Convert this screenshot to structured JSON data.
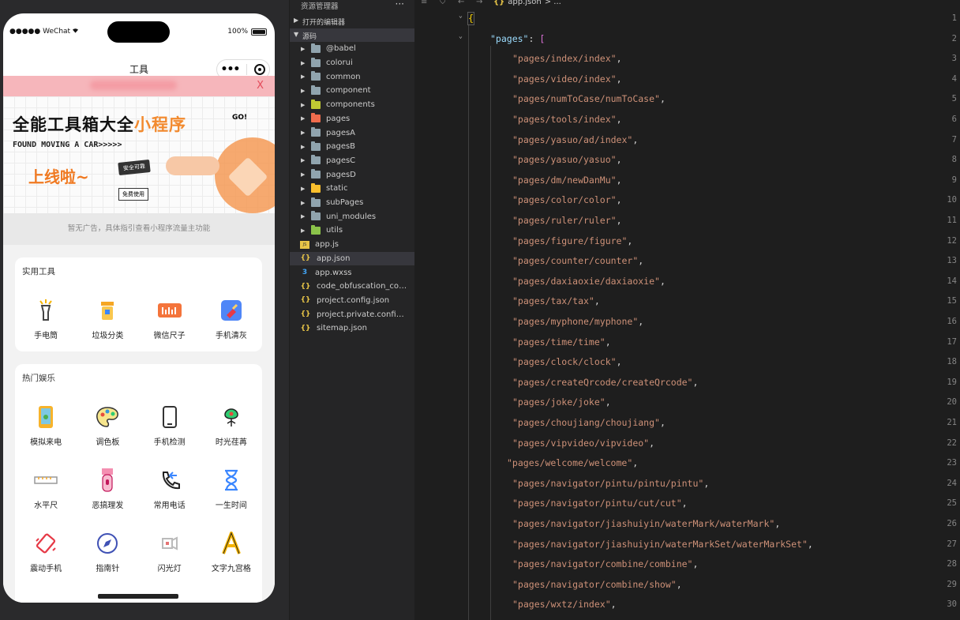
{
  "simulator": {
    "status": {
      "carrier": "●●●●● WeChat",
      "battery_pct": "100%"
    },
    "nav_title": "工具",
    "ad_close": "X",
    "banner": {
      "title_main": "全能工具箱大全",
      "title_highlight": "小程序",
      "subtitle": "FOUND MOVING A CAR>>>>>",
      "launch": "上线啦~",
      "tag1": "安全可靠",
      "tag2": "免费使用",
      "badge": "GO!"
    },
    "notice": "暂无广告，具体指引查看小程序流量主功能",
    "sections": [
      {
        "title": "实用工具",
        "items": [
          {
            "label": "手电筒",
            "icon": "flashlight-icon"
          },
          {
            "label": "垃圾分类",
            "icon": "trash-sort-icon"
          },
          {
            "label": "微信尺子",
            "icon": "ruler-icon"
          },
          {
            "label": "手机清灰",
            "icon": "broom-icon"
          }
        ]
      },
      {
        "title": "热门娱乐",
        "items": [
          {
            "label": "模拟来电",
            "icon": "incoming-call-icon"
          },
          {
            "label": "调色板",
            "icon": "palette-icon"
          },
          {
            "label": "手机检测",
            "icon": "phone-check-icon"
          },
          {
            "label": "时光荏苒",
            "icon": "flower-icon"
          },
          {
            "label": "水平尺",
            "icon": "level-icon"
          },
          {
            "label": "恶搞理发",
            "icon": "clipper-icon"
          },
          {
            "label": "常用电话",
            "icon": "phone-icon"
          },
          {
            "label": "一生时间",
            "icon": "hourglass-icon"
          },
          {
            "label": "震动手机",
            "icon": "vibrate-icon"
          },
          {
            "label": "指南针",
            "icon": "compass-icon"
          },
          {
            "label": "闪光灯",
            "icon": "flash-lamp-icon"
          },
          {
            "label": "文字九宫格",
            "icon": "letter-a-icon"
          }
        ]
      }
    ]
  },
  "explorer": {
    "header": "资源管理器",
    "more": "···",
    "open_editors": "打开的编辑器",
    "source": "源码",
    "tree": [
      {
        "name": "@babel",
        "type": "folder",
        "color": "#90a4ae"
      },
      {
        "name": "colorui",
        "type": "folder",
        "color": "#90a4ae"
      },
      {
        "name": "common",
        "type": "folder",
        "color": "#90a4ae"
      },
      {
        "name": "component",
        "type": "folder",
        "color": "#90a4ae"
      },
      {
        "name": "components",
        "type": "folder",
        "color": "#c0ca33"
      },
      {
        "name": "pages",
        "type": "folder",
        "color": "#ef6c4d"
      },
      {
        "name": "pagesA",
        "type": "folder",
        "color": "#90a4ae"
      },
      {
        "name": "pagesB",
        "type": "folder",
        "color": "#90a4ae"
      },
      {
        "name": "pagesC",
        "type": "folder",
        "color": "#90a4ae"
      },
      {
        "name": "pagesD",
        "type": "folder",
        "color": "#90a4ae"
      },
      {
        "name": "static",
        "type": "folder",
        "color": "#fbc02d"
      },
      {
        "name": "subPages",
        "type": "folder",
        "color": "#90a4ae"
      },
      {
        "name": "uni_modules",
        "type": "folder",
        "color": "#90a4ae"
      },
      {
        "name": "utils",
        "type": "folder",
        "color": "#8bc34a"
      },
      {
        "name": "app.js",
        "type": "js"
      },
      {
        "name": "app.json",
        "type": "json",
        "selected": true
      },
      {
        "name": "app.wxss",
        "type": "wxss"
      },
      {
        "name": "code_obfuscation_conf...",
        "type": "json"
      },
      {
        "name": "project.config.json",
        "type": "json"
      },
      {
        "name": "project.private.config.js...",
        "type": "json"
      },
      {
        "name": "sitemap.json",
        "type": "json"
      }
    ]
  },
  "editor": {
    "breadcrumb": {
      "file": "app.json",
      "rest": "> ..."
    },
    "key": "\"pages\"",
    "lines": [
      "\"pages/index/index\"",
      "\"pages/video/index\"",
      "\"pages/numToCase/numToCase\"",
      "\"pages/tools/index\"",
      "\"pages/yasuo/ad/index\"",
      "\"pages/yasuo/yasuo\"",
      "\"pages/dm/newDanMu\"",
      "\"pages/color/color\"",
      "\"pages/ruler/ruler\"",
      "\"pages/figure/figure\"",
      "\"pages/counter/counter\"",
      "\"pages/daxiaoxie/daxiaoxie\"",
      "\"pages/tax/tax\"",
      "\"pages/myphone/myphone\"",
      "\"pages/time/time\"",
      "\"pages/clock/clock\"",
      "\"pages/createQrcode/createQrcode\"",
      "\"pages/joke/joke\"",
      "\"pages/choujiang/choujiang\"",
      "\"pages/vipvideo/vipvideo\"",
      "\"pages/welcome/welcome\"",
      "\"pages/navigator/pintu/pintu/pintu\"",
      "\"pages/navigator/pintu/cut/cut\"",
      "\"pages/navigator/jiashuiyin/waterMark/waterMark\"",
      "\"pages/navigator/jiashuiyin/waterMarkSet/waterMarkSet\"",
      "\"pages/navigator/combine/combine\"",
      "\"pages/navigator/combine/show\"",
      "\"pages/wxtz/index\""
    ]
  }
}
